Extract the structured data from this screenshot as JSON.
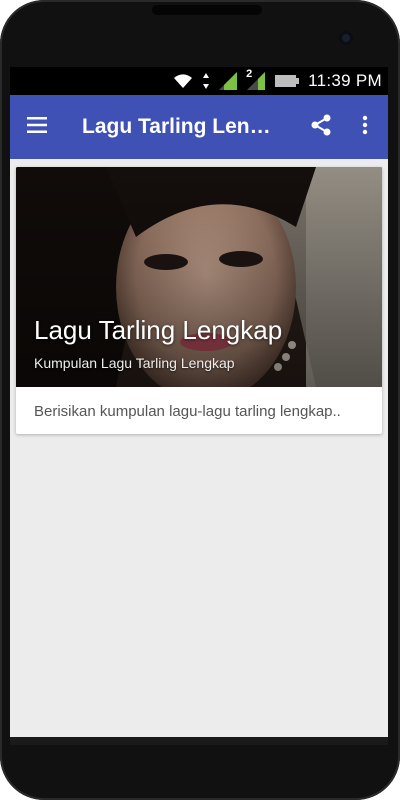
{
  "status_bar": {
    "time": "11:39 PM",
    "sim_label": "2",
    "icons": [
      "wifi-icon",
      "data-arrows-icon",
      "signal-icon",
      "signal-2-icon",
      "battery-icon"
    ]
  },
  "app_bar": {
    "title": "Lagu Tarling Lengkap",
    "icons": [
      "menu-icon",
      "share-icon",
      "more-vert-icon"
    ],
    "color": "#3f51b5"
  },
  "card": {
    "title": "Lagu Tarling Lengkap",
    "subtitle": "Kumpulan Lagu Tarling Lengkap",
    "description": "Berisikan kumpulan lagu-lagu tarling lengkap.."
  }
}
